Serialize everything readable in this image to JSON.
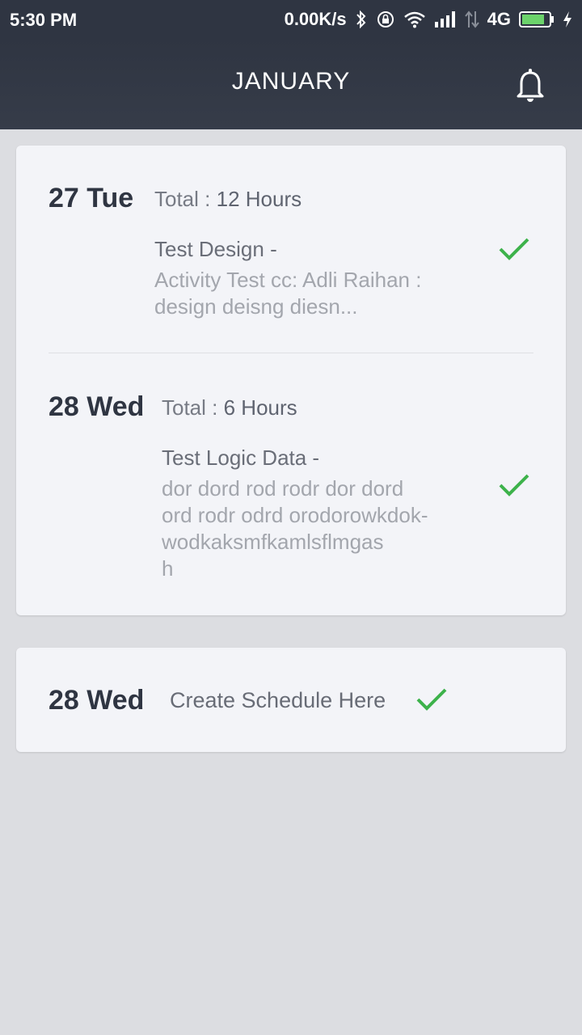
{
  "status_bar": {
    "time": "5:30 PM",
    "net_speed": "0.00K/s",
    "network_type": "4G",
    "icons": [
      "bluetooth-icon",
      "lock-rotation-icon",
      "wifi-icon",
      "signal-icon",
      "data-transfer-icon",
      "battery-icon",
      "charging-icon"
    ]
  },
  "header": {
    "title": "JANUARY",
    "bell_icon": "bell-icon"
  },
  "entries": [
    {
      "day": "27 Tue",
      "total_label": "Total :",
      "total_value": "12 Hours",
      "activity_title": "Test Design -",
      "activity_desc": "Activity Test cc: Adli Raihan :\ndesign deisng diesn..."
    },
    {
      "day": "28 Wed",
      "total_label": "Total :",
      "total_value": "6 Hours",
      "activity_title": "Test Logic Data -",
      "activity_desc": "dor dord rod rodr dor dord\nord rodr odrd orodorowkdok-\nwodkaksmfkamlsflmgas\nh"
    }
  ],
  "schedule": {
    "day": "28 Wed",
    "label": "Create Schedule Here"
  },
  "colors": {
    "header_bg": "#2f3542",
    "page_bg": "#dcdde1",
    "card_bg": "#f3f4f8",
    "check_green": "#3db24b"
  }
}
